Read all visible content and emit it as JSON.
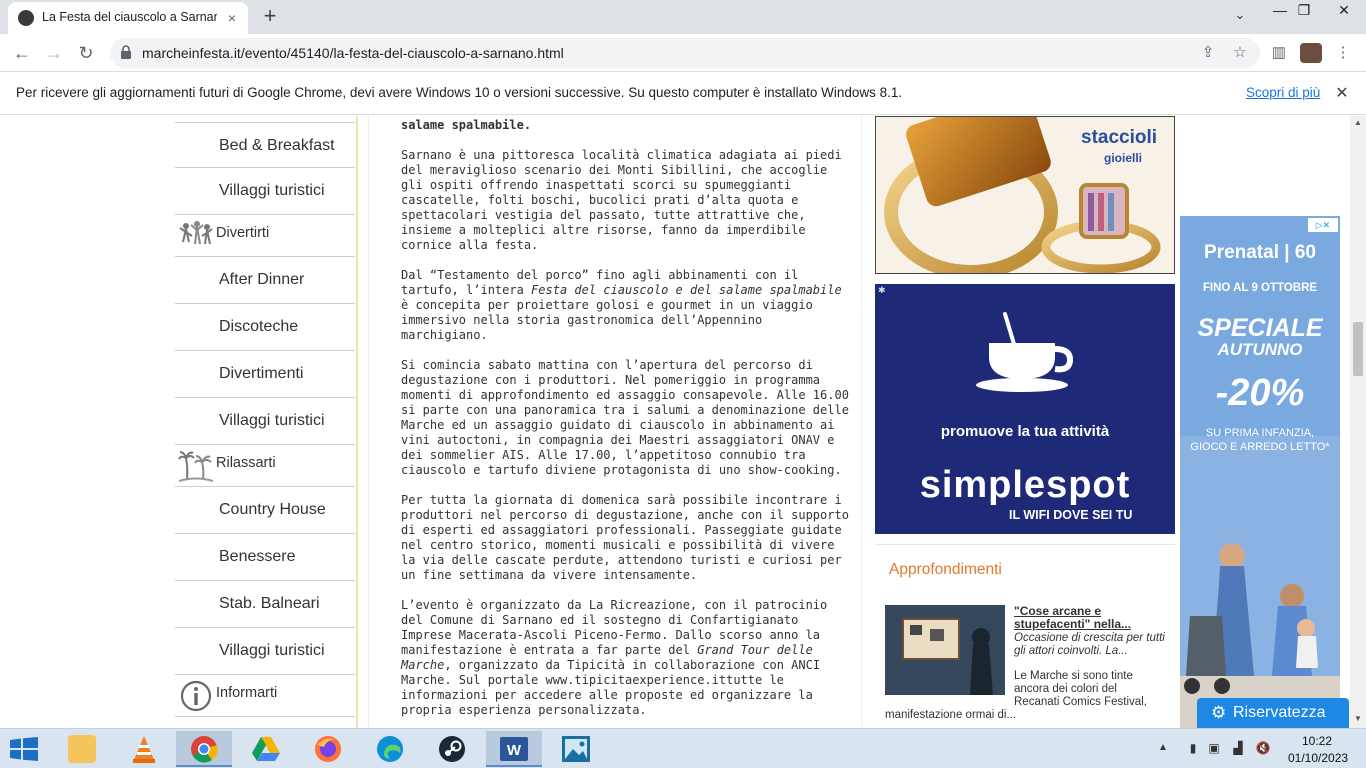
{
  "browser": {
    "tab_title": "La Festa del ciauscolo a Sarnano",
    "tab_close_icon": "×",
    "new_tab_icon": "+",
    "url": "marcheinfesta.it/evento/45140/la-festa-del-ciauscolo-a-sarnano.html",
    "window_controls": {
      "minimize": "—",
      "maximize": "❐",
      "close": "✕"
    }
  },
  "infobar": {
    "message": "Per ricevere gli aggiornamenti futuri di Google Chrome, devi avere Windows 10 o versioni successive. Su questo computer è installato Windows 8.1.",
    "link": "Scopri di più"
  },
  "sidebar": {
    "items": [
      {
        "type": "item",
        "label": "Bed & Breakfast"
      },
      {
        "type": "item",
        "label": "Villaggi turistici"
      },
      {
        "type": "category",
        "label": "Divertirti",
        "icon": "dancers-icon"
      },
      {
        "type": "item",
        "label": "After Dinner"
      },
      {
        "type": "item",
        "label": "Discoteche"
      },
      {
        "type": "item",
        "label": "Divertimenti"
      },
      {
        "type": "item",
        "label": "Villaggi turistici"
      },
      {
        "type": "category",
        "label": "Rilassarti",
        "icon": "palm-trees-icon"
      },
      {
        "type": "item",
        "label": "Country House"
      },
      {
        "type": "item",
        "label": "Benessere"
      },
      {
        "type": "item",
        "label": "Stab. Balneari"
      },
      {
        "type": "item",
        "label": "Villaggi turistici"
      },
      {
        "type": "category",
        "label": "Informarti",
        "icon": "info-icon"
      }
    ]
  },
  "article": {
    "para0": "salame spalmabile.",
    "para1": "Sarnano è una pittoresca località climatica adagiata ai piedi\ndel meraviglioso scenario dei Monti Sibillini, che accoglie\ngli ospiti offrendo inaspettati scorci su spumeggianti\ncascatelle, folti boschi, bucolici prati d’alta quota e\nspettacolari vestigia del passato, tutte attrattive che,\ninsieme a molteplici altre risorse, fanno da imperdibile\ncornice alla festa.",
    "para2_a": "Dal “Testamento del porco” fino agli abbinamenti con il\ntartufo, l’intera ",
    "para2_em": "Festa del ciauscolo e del salame spalmabile",
    "para2_b": "\nè concepita per proiettare golosi e gourmet in un viaggio\nimmersivo nella storia gastronomica dell’Appennino\nmarchigiano.",
    "para3": "Si comincia sabato mattina con l’apertura del percorso di\ndegustazione con i produttori. Nel pomeriggio in programma\nmomenti di approfondimento ed assaggio consapevole. Alle 16.00\nsi parte con una panoramica tra i salumi a denominazione delle\nMarche ed un assaggio guidato di ciauscolo in abbinamento ai\nvini autoctoni, in compagnia dei Maestri assaggiatori ONAV e\ndei sommelier AIS. Alle 17.00, l’appetitoso connubio tra\nciauscolo e tartufo diviene protagonista di uno show-cooking.",
    "para4": "Per tutta la giornata di domenica sarà possibile incontrare i\nproduttori nel percorso di degustazione, anche con il supporto\ndi esperti ed assaggiatori professionali. Passeggiate guidate\nnel centro storico, momenti musicali e possibilità di vivere\nla via delle cascate perdute, attendono turisti e curiosi per\nun fine settimana da vivere intensamente.",
    "para5_a": "L’evento è organizzato da La Ricreazione, con il patrocinio\ndel Comune di Sarnano ed il sostegno di Confartigianato\nImprese Macerata-Ascoli Piceno-Fermo. Dallo scorso anno la\nmanifestazione è entrata a far parte del ",
    "para5_em1": "Grand Tour delle\nMarche",
    "para5_b": ", organizzato da Tipicità in collaborazione con ANCI\nMarche. Sul portale www.tipicitaexperience.ittutte le\ninformazioni per accedere alle proposte ed organizzare la\npropria esperienza personalizzata."
  },
  "ads": {
    "jewel_brand": "staccioli",
    "jewel_sub": "gioielli",
    "simplespot_tagline": "promuove la tua attività",
    "simplespot_logo": "simplespot",
    "simplespot_claim": "IL WIFI DOVE SEI TU",
    "prenatal_brand": "Prenatal | 60",
    "prenatal_date": "FINO AL 9 OTTOBRE",
    "prenatal_speciale": "SPECIALE",
    "prenatal_autunno": "AUTUNNO",
    "prenatal_discount": "-20%",
    "prenatal_sub": "SU PRIMA INFANZIA,\nGIOCO E ARREDO LETTO*"
  },
  "approfondimenti": {
    "title": "Approfondimenti",
    "link": "\"Cose arcane e stupefacenti\" nella...",
    "excerpt": "Occasione di crescita per tutti gli attori coinvolti. La...",
    "desc_a": "Le Marche si sono tinte ancora dei colori del Recanati Comics Festival,",
    "desc_b": "manifestazione ormai di..."
  },
  "privacy_button": "Riservatezza",
  "taskbar": {
    "time": "10:22",
    "date": "01/10/2023"
  }
}
